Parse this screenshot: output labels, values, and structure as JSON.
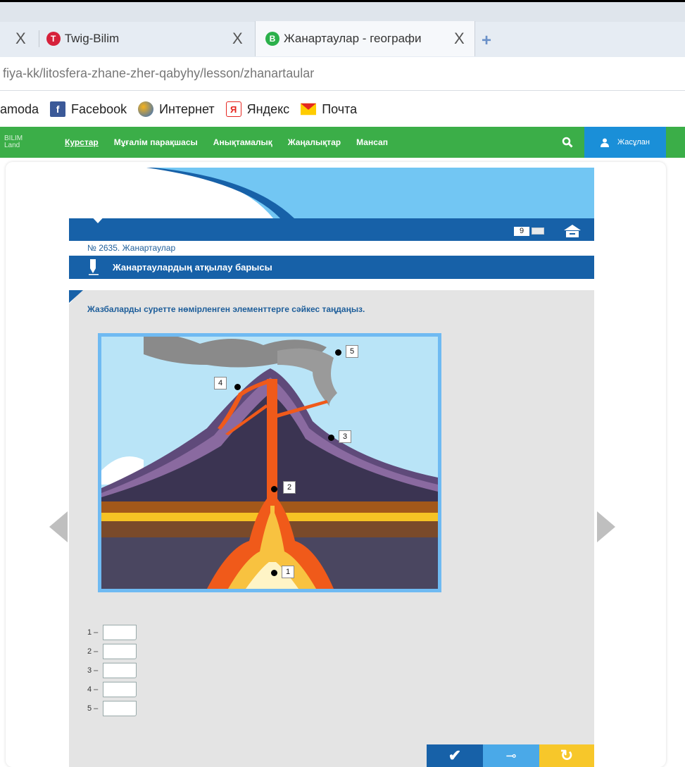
{
  "browser": {
    "tabs": [
      {
        "label": "Twig-Bilim",
        "favicon_letter": "T",
        "favicon_color": "#d6213b"
      },
      {
        "label": "Жанартаулар - географи",
        "favicon_letter": "B",
        "favicon_color": "#2bb04b"
      }
    ],
    "tab_close": "X",
    "new_tab": "+",
    "url": "fiya-kk/litosfera-zhane-zher-qabyhy/lesson/zhanartaular",
    "bookmarks": [
      {
        "label": "amoda",
        "icon": ""
      },
      {
        "label": "Facebook",
        "icon": "facebook-icon"
      },
      {
        "label": "Интернет",
        "icon": "globe-icon"
      },
      {
        "label": "Яндекс",
        "icon": "yandex-icon"
      },
      {
        "label": "Почта",
        "icon": "mail-icon"
      }
    ]
  },
  "site_nav": {
    "logo_line1": "BILIM",
    "logo_line2": "Land",
    "items": [
      "Курстар",
      "Мұғалім парақшасы",
      "Анықтамалық",
      "Жаңалықтар",
      "Мансап"
    ],
    "user_label": "Жасұлан",
    "accent": "#3bae48"
  },
  "lesson": {
    "page_number": "9",
    "lesson_id": "№ 2635. Жанартаулар",
    "topic": "Жанартаулардың атқылау барысы",
    "instruction": "Жазбаларды суретте нөмірленген элементтерге сәйкес таңдаңыз.",
    "figure_labels": [
      "1",
      "2",
      "3",
      "4",
      "5"
    ],
    "answers": [
      {
        "num": "1 –",
        "value": ""
      },
      {
        "num": "2 –",
        "value": ""
      },
      {
        "num": "3 –",
        "value": ""
      },
      {
        "num": "4 –",
        "value": ""
      },
      {
        "num": "5 –",
        "value": ""
      }
    ],
    "buttons": {
      "check": "✔",
      "key": "⊸",
      "reset": "↻"
    }
  }
}
